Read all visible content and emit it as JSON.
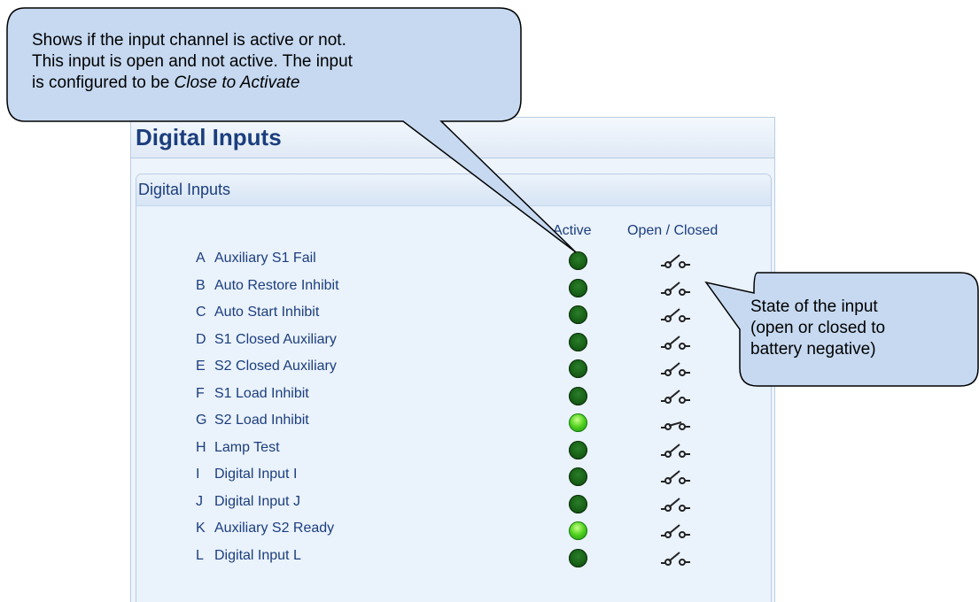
{
  "panel": {
    "title": "Digital Inputs",
    "group_title": "Digital Inputs",
    "col_active": "Active",
    "col_state": "Open / Closed"
  },
  "inputs": [
    {
      "letter": "A",
      "label": "Auxiliary S1 Fail",
      "active": false,
      "state": "open"
    },
    {
      "letter": "B",
      "label": "Auto Restore Inhibit",
      "active": false,
      "state": "open"
    },
    {
      "letter": "C",
      "label": "Auto Start Inhibit",
      "active": false,
      "state": "open"
    },
    {
      "letter": "D",
      "label": "S1 Closed Auxiliary",
      "active": false,
      "state": "open"
    },
    {
      "letter": "E",
      "label": "S2 Closed Auxiliary",
      "active": false,
      "state": "open"
    },
    {
      "letter": "F",
      "label": "S1 Load Inhibit",
      "active": false,
      "state": "open"
    },
    {
      "letter": "G",
      "label": "S2 Load Inhibit",
      "active": true,
      "state": "closed"
    },
    {
      "letter": "H",
      "label": "Lamp Test",
      "active": false,
      "state": "open"
    },
    {
      "letter": "I",
      "label": "Digital Input I",
      "active": false,
      "state": "open"
    },
    {
      "letter": "J",
      "label": "Digital Input J",
      "active": false,
      "state": "open"
    },
    {
      "letter": "K",
      "label": "Auxiliary S2 Ready",
      "active": true,
      "state": "open"
    },
    {
      "letter": "L",
      "label": "Digital Input L",
      "active": false,
      "state": "open"
    }
  ],
  "callouts": {
    "active": {
      "line1": "Shows if the input channel is active or not.",
      "line2": "This input is open and not active. The input",
      "line3_prefix": "is configured to be ",
      "line3_italic": "Close to Activate"
    },
    "state": {
      "line1": "State of the input",
      "line2": "(open or closed to",
      "line3": "battery negative)"
    }
  },
  "colors": {
    "label_text": "#1b3e7d",
    "callout_fill": "#c6d9f1",
    "led_inactive": "#176017",
    "led_active": "#4fd11e"
  }
}
